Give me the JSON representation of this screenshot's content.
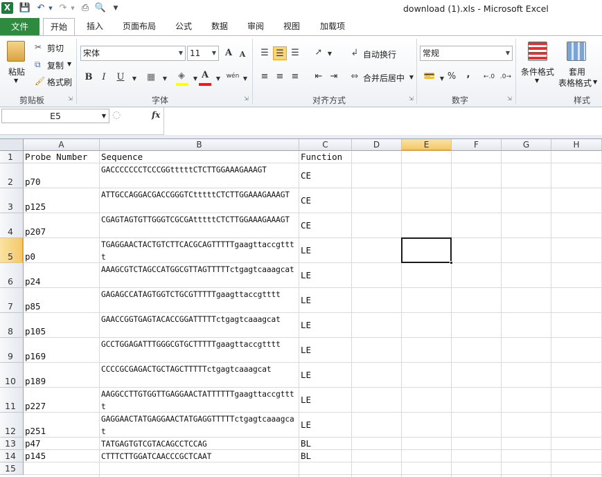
{
  "window": {
    "title": "download (1).xls  -  Microsoft Excel"
  },
  "quick_access": {
    "app_icon": "X",
    "save_icon": "save-icon",
    "undo_icon": "undo-icon",
    "redo_icon": "redo-icon",
    "print_icon": "print-icon",
    "preview_icon": "print-preview-icon"
  },
  "tabs": [
    "文件",
    "开始",
    "插入",
    "页面布局",
    "公式",
    "数据",
    "审阅",
    "视图",
    "加载项"
  ],
  "ribbon": {
    "clipboard": {
      "paste": "粘贴",
      "cut": "剪切",
      "copy": "复制",
      "format_painter": "格式刷",
      "label": "剪贴板"
    },
    "font": {
      "name": "宋体",
      "size": "11",
      "bold": "B",
      "italic": "I",
      "underline": "U",
      "label": "字体",
      "grow": "A",
      "shrink": "A",
      "wen": "wén"
    },
    "alignment": {
      "wrap": "自动换行",
      "merge": "合并后居中",
      "label": "对齐方式"
    },
    "number": {
      "format": "常规",
      "percent": "%",
      "comma": ",",
      "label": "数字"
    },
    "styles": {
      "conditional": "条件格式",
      "table_line1": "套用",
      "table_line2": "表格格式",
      "label": "样式"
    }
  },
  "formula_bar": {
    "name_box": "E5",
    "fx": "fx",
    "value": ""
  },
  "sheet": {
    "columns": [
      "A",
      "B",
      "C",
      "D",
      "E",
      "F",
      "G",
      "H"
    ],
    "active_cell": "E5",
    "rows": [
      {
        "num": "1",
        "a": "Probe Number",
        "b": "Sequence",
        "c": "Function"
      },
      {
        "num": "2",
        "a": "p70",
        "b": "GACCCCCCCTCCCGGtttttCTCTTGGAAAGAAAGT",
        "c": "CE"
      },
      {
        "num": "3",
        "a": "p125",
        "b": "ATTGCCAGGACGACCGGGTCtttttCTCTTGGAAAGAAAGT",
        "c": "CE"
      },
      {
        "num": "4",
        "a": "p207",
        "b": "CGAGTAGTGTTGGGTCGCGAtttttCTCTTGGAAAGAAAGT",
        "c": "CE"
      },
      {
        "num": "5",
        "a": "p0",
        "b": "TGAGGAACTACTGTCTTCACGCAGTTTTTgaagttaccgtttt",
        "c": "LE"
      },
      {
        "num": "6",
        "a": "p24",
        "b": "AAAGCGTCTAGCCATGGCGTTAGTTTTTctgagtcaaagcat",
        "c": "LE"
      },
      {
        "num": "7",
        "a": "p85",
        "b": "GAGAGCCATAGTGGTCTGCGTTTTTgaagttaccgtttt",
        "c": "LE"
      },
      {
        "num": "8",
        "a": "p105",
        "b": "GAACCGGTGAGTACACCGGATTTTTctgagtcaaagcat",
        "c": "LE"
      },
      {
        "num": "9",
        "a": "p169",
        "b": "GCCTGGAGATTTGGGCGTGCTTTTTgaagttaccgtttt",
        "c": "LE"
      },
      {
        "num": "10",
        "a": "p189",
        "b": "CCCCGCGAGACTGCTAGCTTTTTctgagtcaaagcat",
        "c": "LE"
      },
      {
        "num": "11",
        "a": "p227",
        "b": "AAGGCCTTGTGGTTGAGGAACTATTTTTTgaagttaccgtttt",
        "c": "LE"
      },
      {
        "num": "12",
        "a": "p251",
        "b": "GAGGAACTATGAGGAACTATGAGGTTTTTctgagtcaaagcat",
        "c": "LE"
      },
      {
        "num": "13",
        "a": "p47",
        "b": "TATGAGTGTCGTACAGCCTCCAG",
        "c": "BL"
      },
      {
        "num": "14",
        "a": "p145",
        "b": "CTTTCTTGGATCAACCCGCTCAAT",
        "c": "BL"
      },
      {
        "num": "15",
        "a": "",
        "b": "",
        "c": ""
      }
    ]
  }
}
